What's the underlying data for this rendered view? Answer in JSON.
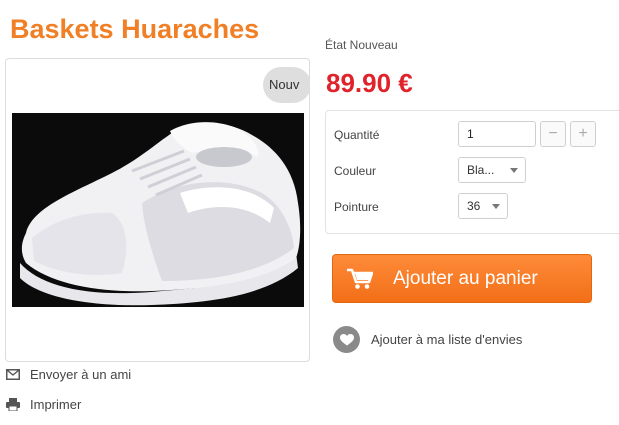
{
  "product": {
    "title": "Baskets Huaraches",
    "badge": "Nouv",
    "condition": "État Nouveau",
    "price": "89.90 €"
  },
  "options": {
    "quantity_label": "Quantité",
    "quantity_value": "1",
    "minus": "−",
    "plus": "+",
    "color_label": "Couleur",
    "color_value": "Bla...",
    "size_label": "Pointure",
    "size_value": "36"
  },
  "actions": {
    "add_to_cart": "Ajouter au panier",
    "wishlist": "Ajouter à ma liste d'envies",
    "send_friend": "Envoyer à un ami",
    "print": "Imprimer"
  },
  "colors": {
    "title_orange": "#f07f25",
    "price_red": "#e0232b",
    "button_orange": "#f26f17"
  },
  "icons": {
    "cart": "cart-icon",
    "heart": "heart-icon",
    "envelope": "envelope-icon",
    "printer": "printer-icon",
    "caret": "chevron-down-icon"
  }
}
